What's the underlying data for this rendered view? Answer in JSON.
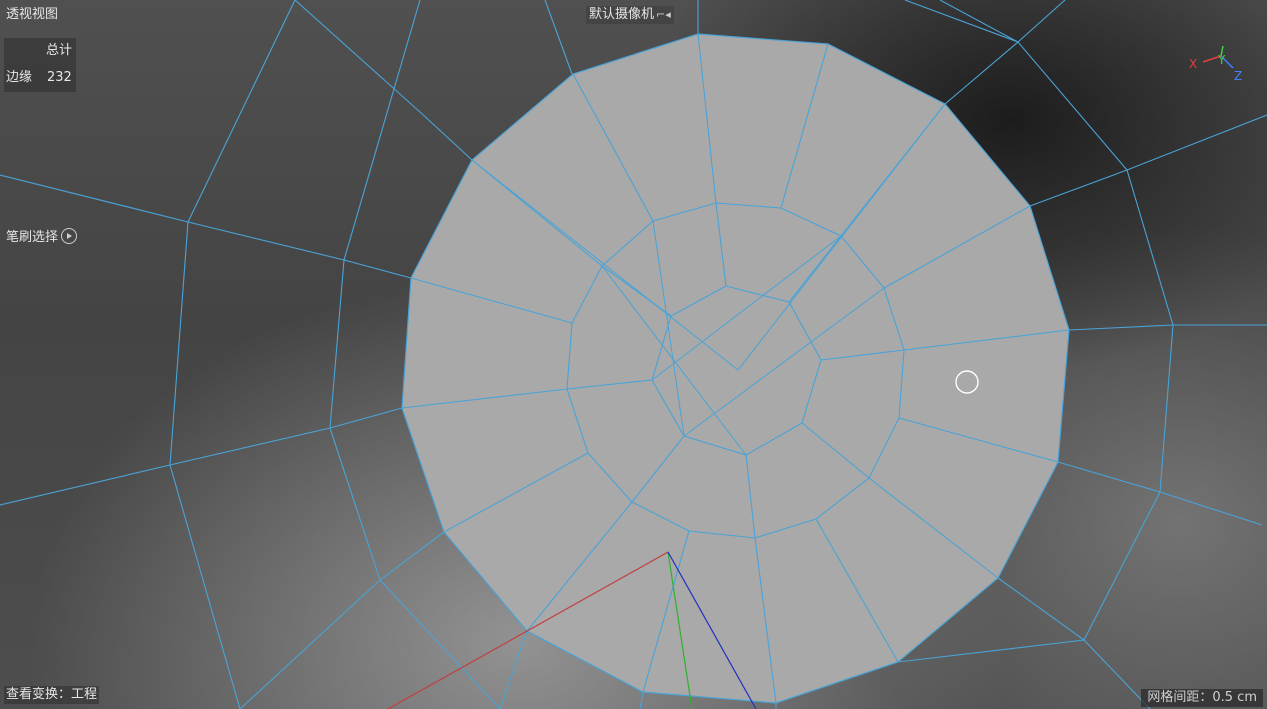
{
  "viewport": {
    "title": "透视视图",
    "camera_label": "默认摄像机",
    "camera_icon": "⌐◂",
    "brush_label": "笔刷选择",
    "transform_label": "查看变换：工程",
    "grid_label": "网格间距：0.5 cm"
  },
  "stats": {
    "header": "总计",
    "row_label": "边缘",
    "row_value": "232"
  },
  "gizmo": {
    "x": "X",
    "y": "Y",
    "z": "Z",
    "colors": {
      "x": "#e04040",
      "y": "#40d040",
      "z": "#4080ff"
    }
  },
  "colors": {
    "edge": "#4aa3d6",
    "face": "#a9a9a9",
    "axis_x": "#c04040",
    "axis_y": "#30b030",
    "axis_z": "#2030c0"
  }
}
